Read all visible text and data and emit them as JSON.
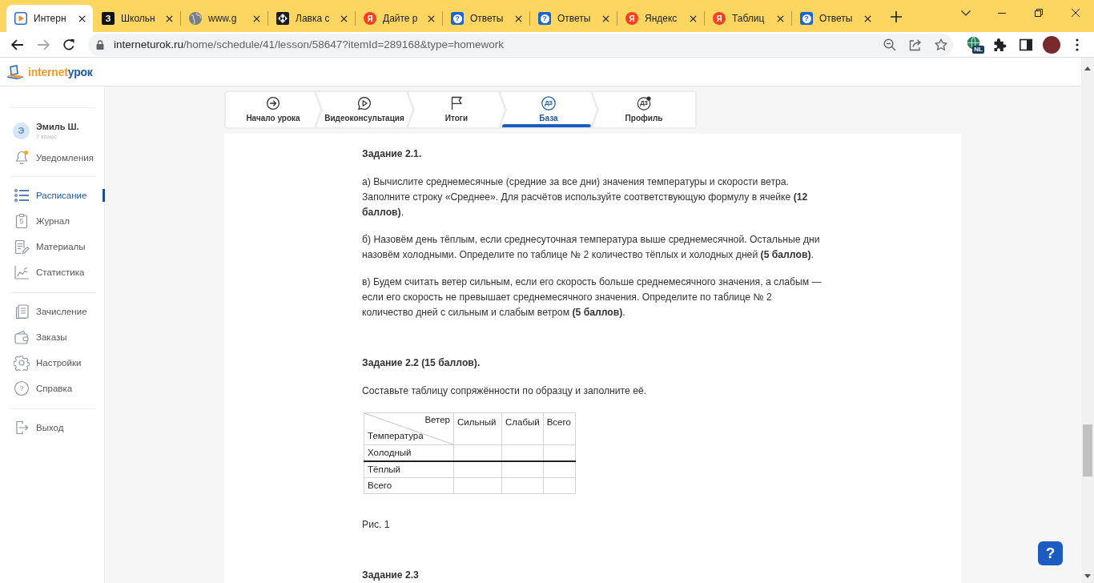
{
  "browser": {
    "tabs": [
      {
        "kind": "play",
        "title": "Интерн",
        "selected": true
      },
      {
        "kind": "letter",
        "glyph": "З",
        "title": "Школьн",
        "selected": false
      },
      {
        "kind": "globe",
        "title": "www.g",
        "selected": false
      },
      {
        "kind": "emblem",
        "title": "Лавка с",
        "selected": false
      },
      {
        "kind": "yandex",
        "glyph": "Я",
        "title": "Дайте р",
        "selected": false
      },
      {
        "kind": "answers",
        "glyph": "?",
        "title": "Ответы",
        "selected": false
      },
      {
        "kind": "answers",
        "glyph": "?",
        "title": "Ответы",
        "selected": false
      },
      {
        "kind": "yandex",
        "glyph": "Я",
        "title": "Яндекс",
        "selected": false
      },
      {
        "kind": "yandex",
        "glyph": "Я",
        "title": "Таблиц",
        "selected": false
      },
      {
        "kind": "answers",
        "glyph": "?",
        "title": "Ответы",
        "selected": false
      }
    ],
    "address_bar": {
      "host": "interneturok.ru",
      "path": "/home/schedule/41/lesson/58647?itemId=289168&type=homework"
    },
    "extension_badge": "NL"
  },
  "site_header": {
    "logo_first": "internet",
    "logo_second": "урок"
  },
  "sidebar": {
    "user": {
      "initial": "Э",
      "name": "Эмиль Ш.",
      "grade": "7 класс"
    },
    "groups": [
      {
        "items": [
          {
            "label": "Уведомления",
            "selected": false,
            "alert": true
          }
        ]
      },
      {
        "items": [
          {
            "label": "Расписание",
            "selected": true,
            "alert": false
          },
          {
            "label": "Журнал",
            "icon_text": "5",
            "selected": false,
            "alert": false
          },
          {
            "label": "Материалы",
            "selected": false,
            "alert": false
          },
          {
            "label": "Статистика",
            "selected": false,
            "alert": false
          }
        ]
      },
      {
        "items": [
          {
            "label": "Зачисление",
            "selected": false,
            "alert": false
          },
          {
            "label": "Заказы",
            "selected": false,
            "alert": false
          },
          {
            "label": "Настройки",
            "selected": false,
            "alert": false
          },
          {
            "label": "Справка",
            "icon_text": "?",
            "selected": false,
            "alert": false
          }
        ]
      },
      {
        "items": [
          {
            "label": "Выход",
            "selected": false,
            "alert": false
          }
        ]
      }
    ]
  },
  "lesson_steps": [
    {
      "label": "Начало урока",
      "selected": false
    },
    {
      "label": "Видеоконсультация",
      "selected": false
    },
    {
      "label": "Итоги",
      "selected": false
    },
    {
      "label": "База",
      "icon_text": "ДЗ",
      "selected": true
    },
    {
      "label": "Профиль",
      "icon_text": "ДЗ",
      "selected": false
    }
  ],
  "tasks": [
    {
      "title": "Задание 2.1.",
      "paragraphs": [
        "а) Вычислите среднемесячные (средние за все дни) значения температуры и скорости ветра. Заполните строку «Среднее». Для расчётов используйте соответствующую формулу в ячейке **(12 баллов)**.",
        "б) Назовём день тёплым, если среднесуточная температура выше среднемесячной. Остальные дни назовём холодными. Определите по таблице № 2 количество тёплых и холодных дней **(5 баллов)**.",
        "в) Будем считать ветер сильным, если его скорость больше среднемесячного значения, а слабым — если его скорость не превышает среднемесячного значения. Определите по таблице № 2 количество дней с сильным и слабым ветром **(5 баллов)**."
      ]
    },
    {
      "title": "Задание 2.2 (15 баллов).",
      "paragraphs": [
        "Составьте таблицу сопряжённости по образцу и заполните её."
      ],
      "table": {
        "corner_top": "Ветер",
        "corner_bottom": "Температура",
        "columns": [
          "Сильный",
          "Слабый",
          "Всего"
        ],
        "rows": [
          {
            "label": "Холодный",
            "rule_above": false
          },
          {
            "label": "Тёплый",
            "rule_above": true
          },
          {
            "label": "Всего",
            "rule_above": false
          }
        ]
      },
      "caption": "Рис. 1"
    },
    {
      "title": "Задание 2.3"
    }
  ],
  "help_button": "?"
}
